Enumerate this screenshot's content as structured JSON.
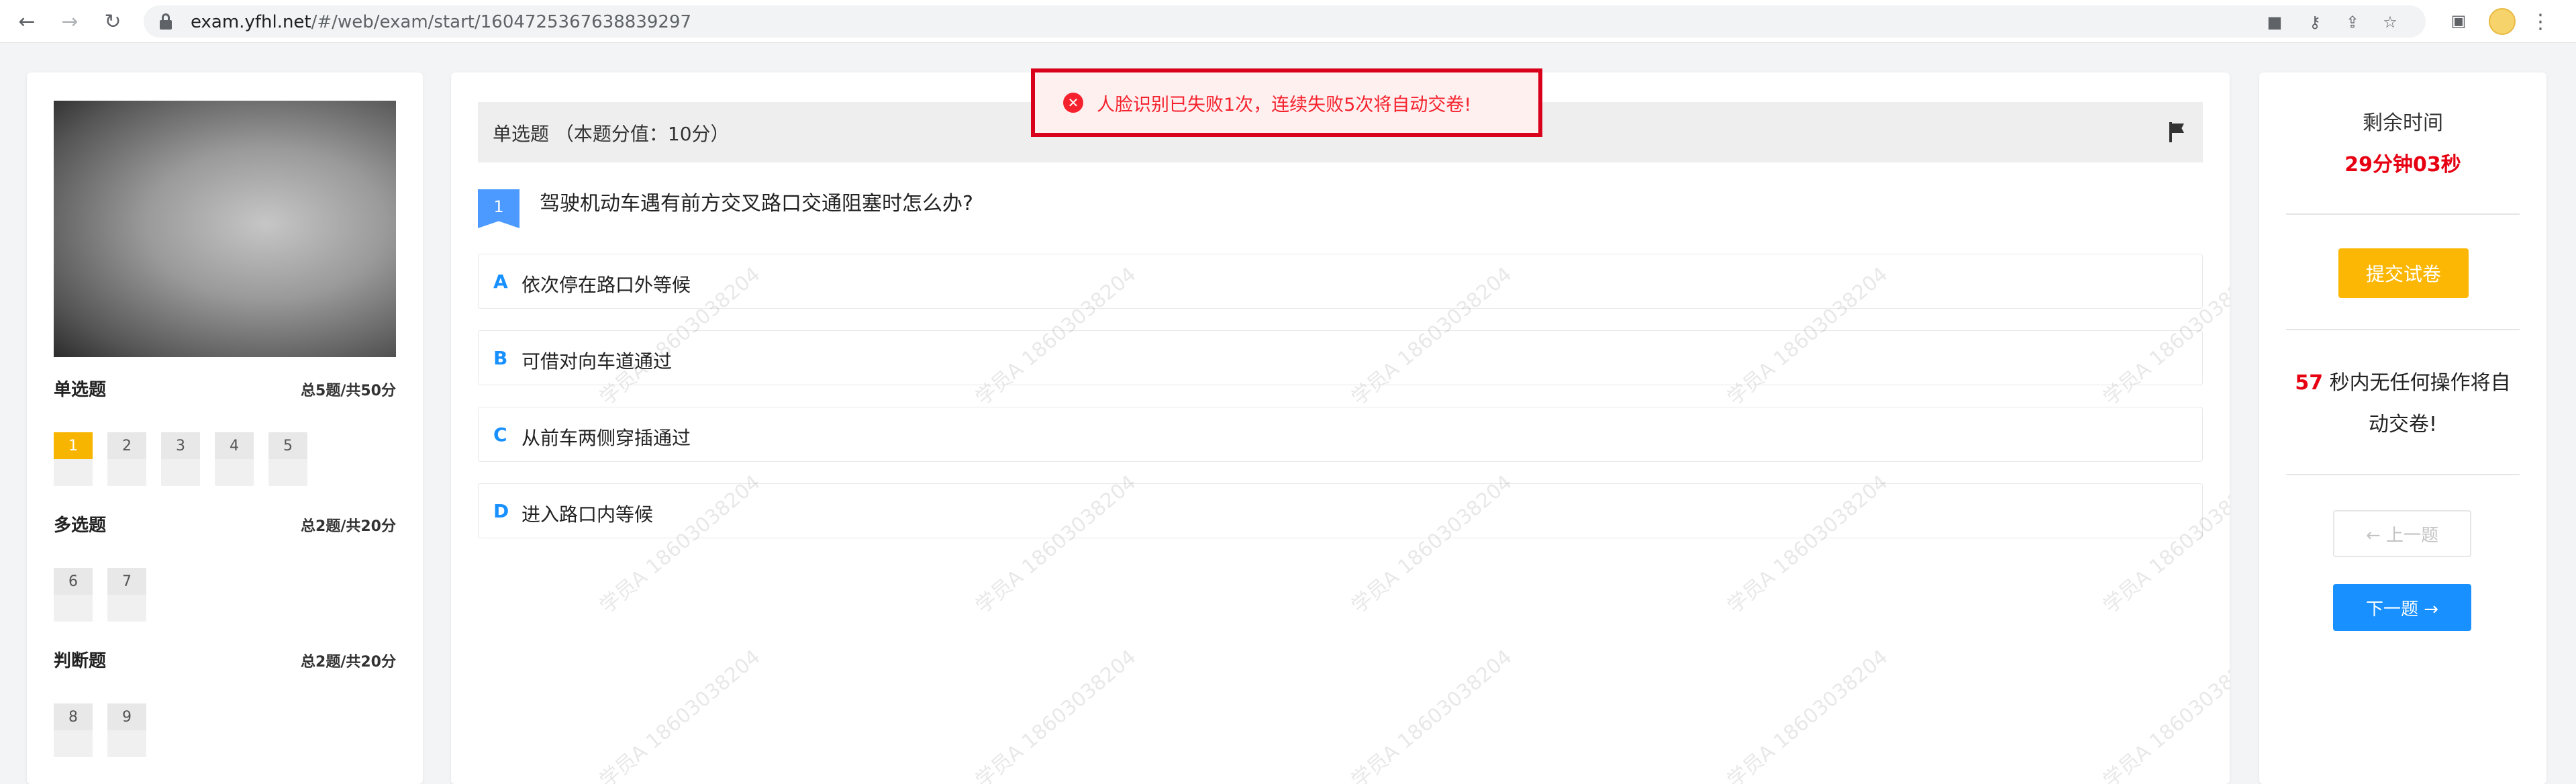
{
  "browser": {
    "url_host": "exam.yfhl.net",
    "url_path": "/#/web/exam/start/1604725367638839297"
  },
  "alert": {
    "message": "人脸识别已失败1次，连续失败5次将自动交卷!"
  },
  "sidebar": {
    "sections": [
      {
        "title": "单选题",
        "summary": "总5题/共50分",
        "questions": [
          "1",
          "2",
          "3",
          "4",
          "5"
        ],
        "active": "1"
      },
      {
        "title": "多选题",
        "summary": "总2题/共20分",
        "questions": [
          "6",
          "7"
        ]
      },
      {
        "title": "判断题",
        "summary": "总2题/共20分",
        "questions": [
          "8",
          "9"
        ]
      }
    ]
  },
  "question": {
    "type_label": "单选题 （本题分值：10分）",
    "number": "1",
    "text": "驾驶机动车遇有前方交叉路口交通阻塞时怎么办?",
    "options": [
      {
        "letter": "A",
        "text": "依次停在路口外等候"
      },
      {
        "letter": "B",
        "text": "可借对向车道通过"
      },
      {
        "letter": "C",
        "text": "从前车两侧穿插通过"
      },
      {
        "letter": "D",
        "text": "进入路口内等候"
      }
    ]
  },
  "watermark": "学员A 18603038204",
  "timer": {
    "label": "剩余时间",
    "value": "29分钟03秒"
  },
  "actions": {
    "submit_label": "提交试卷",
    "idle_seconds": "57",
    "idle_text": " 秒内无任何操作将自动交卷!",
    "prev_label": "← 上一题",
    "next_label": "下一题 →"
  },
  "colors": {
    "accent_blue": "#1890ff",
    "submit_yellow": "#fbb703",
    "timer_red": "#e60012",
    "alert_border": "#d9001b"
  }
}
